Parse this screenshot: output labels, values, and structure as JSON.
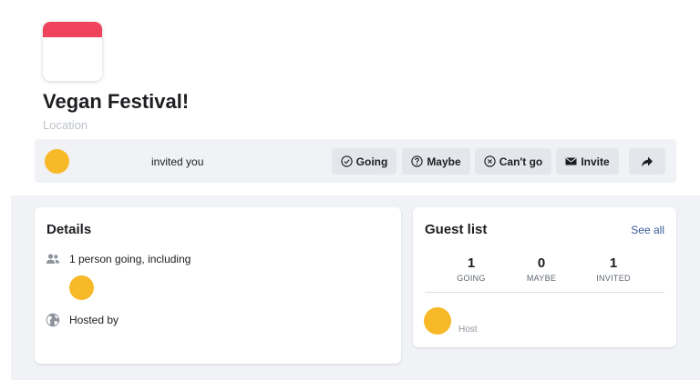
{
  "event": {
    "title": "Vegan Festival!",
    "location_placeholder": "Location"
  },
  "invite_bar": {
    "invited_text": "invited you",
    "buttons": {
      "going": "Going",
      "maybe": "Maybe",
      "cant_go": "Can't go",
      "invite": "Invite"
    },
    "share_icon": "share-arrow-icon"
  },
  "details": {
    "title": "Details",
    "going_text": "1 person going, including",
    "hosted_text": "Hosted by"
  },
  "guest_list": {
    "title": "Guest list",
    "see_all": "See all",
    "stats": [
      {
        "count": "1",
        "label": "GOING"
      },
      {
        "count": "0",
        "label": "MAYBE"
      },
      {
        "count": "1",
        "label": "INVITED"
      }
    ],
    "host_label": "Host"
  },
  "colors": {
    "calendar_accent": "#f0435c",
    "avatar": "#f7b928",
    "link": "#385898",
    "background": "#f0f2f5"
  }
}
